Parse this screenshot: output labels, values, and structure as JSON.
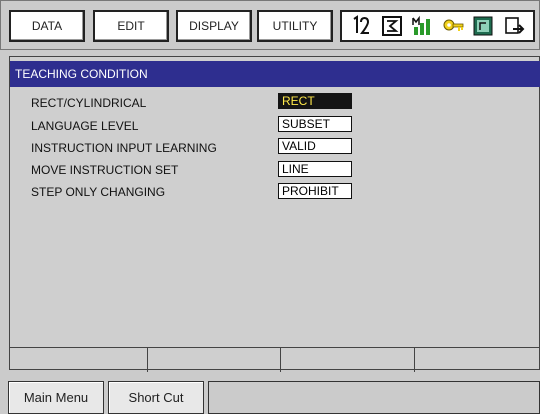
{
  "menu": {
    "data_label": "DATA",
    "edit_label": "EDIT",
    "display_label": "DISPLAY",
    "utility_label": "UTILITY"
  },
  "status_icons": [
    "cycle-mode-icon",
    "step-icon",
    "manual-speed-icon",
    "security-key-icon",
    "coordinate-icon",
    "page-output-icon"
  ],
  "panel": {
    "title": "TEACHING CONDITION",
    "rows": [
      {
        "label": "RECT/CYLINDRICAL",
        "value": "RECT",
        "selected": true
      },
      {
        "label": "LANGUAGE LEVEL",
        "value": "SUBSET",
        "selected": false
      },
      {
        "label": "INSTRUCTION INPUT LEARNING",
        "value": "VALID",
        "selected": false
      },
      {
        "label": "MOVE INSTRUCTION SET",
        "value": "LINE",
        "selected": false
      },
      {
        "label": "STEP ONLY CHANGING",
        "value": "PROHIBIT",
        "selected": false
      }
    ]
  },
  "bottom": {
    "main_menu_label": "Main Menu",
    "short_cut_label": "Short Cut"
  },
  "colors": {
    "title_bar": "#2e2e8f",
    "selected_bg": "#141414",
    "selected_text": "#ffe94a",
    "background": "#cbcbcb"
  }
}
